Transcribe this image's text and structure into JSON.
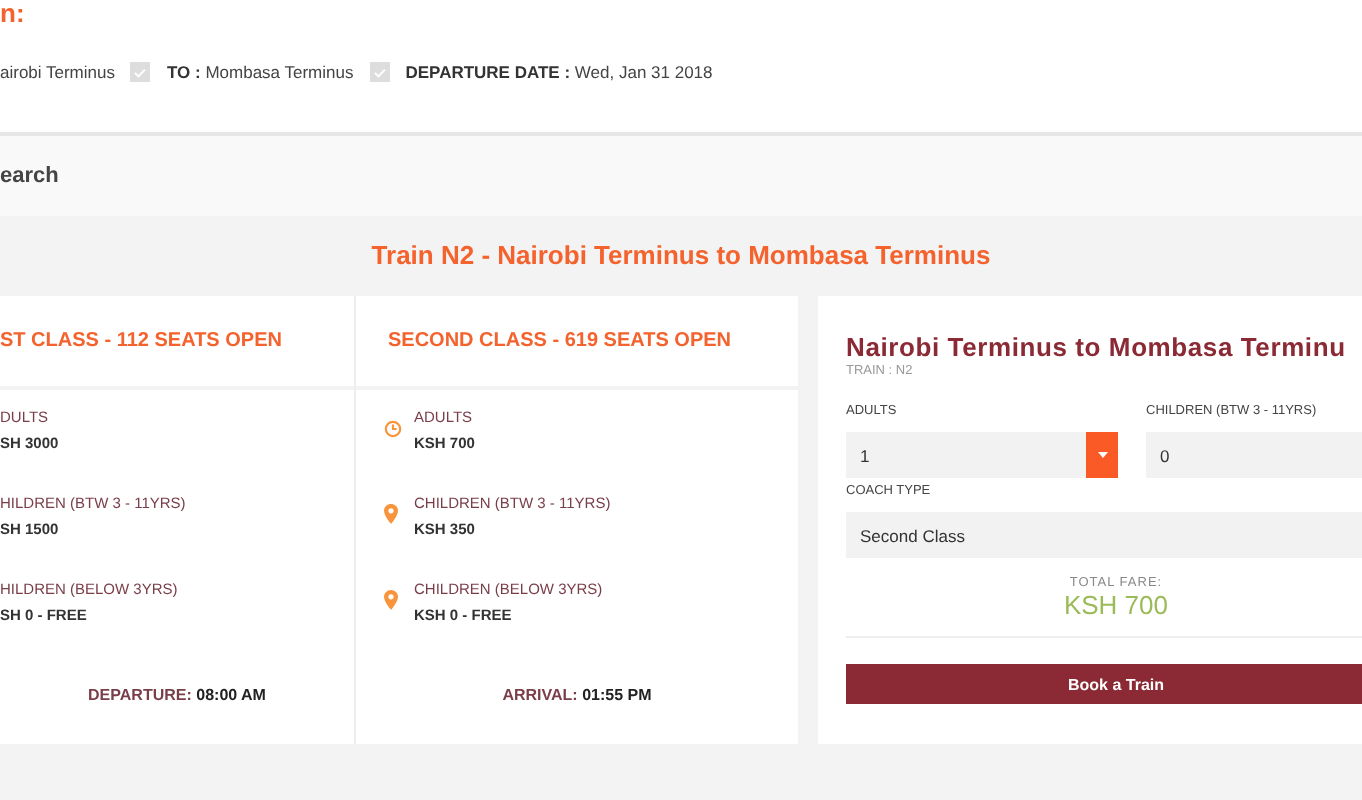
{
  "heading": "n:",
  "route": [
    {
      "text": "airobi Terminus",
      "checked": true
    },
    {
      "label": "TO :",
      "text": "Mombasa Terminus",
      "checked": true
    },
    {
      "label": "DEPARTURE DATE :",
      "text": "Wed, Jan 31 2018"
    }
  ],
  "search_title": "earch",
  "train_title": "Train N2 - Nairobi Terminus to Mombasa Terminus",
  "classes": [
    {
      "title": "ST CLASS - 112 SEATS OPEN",
      "fares": [
        {
          "label": "DULTS",
          "price": "SH 3000"
        },
        {
          "label": "HILDREN (BTW 3 - 11YRS)",
          "price": "SH 1500"
        },
        {
          "label": "HILDREN (BELOW 3YRS)",
          "price": "SH 0 - FREE"
        }
      ],
      "time_label": "DEPARTURE:",
      "time": "08:00 AM"
    },
    {
      "title": "SECOND CLASS - 619 SEATS OPEN",
      "fares": [
        {
          "kind": "clock",
          "label": "ADULTS",
          "price": "KSH 700"
        },
        {
          "kind": "pin",
          "label": "CHILDREN (BTW 3 - 11YRS)",
          "price": "KSH 350"
        },
        {
          "kind": "pin",
          "label": "CHILDREN (BELOW 3YRS)",
          "price": "KSH 0 - FREE"
        }
      ],
      "time_label": "ARRIVAL:",
      "time": "01:55 PM"
    }
  ],
  "booking": {
    "title": "Nairobi Terminus to Mombasa Terminu",
    "subtitle": "TRAIN : N2",
    "adults_label": "ADULTS",
    "adults_value": "1",
    "children_label": "CHILDREN (BTW 3 - 11YRS)",
    "children_value": "0",
    "coach_label": "COACH TYPE",
    "coach_value": "Second Class",
    "total_label": "TOTAL FARE:",
    "total": "KSH 700",
    "button": "Book a Train"
  }
}
